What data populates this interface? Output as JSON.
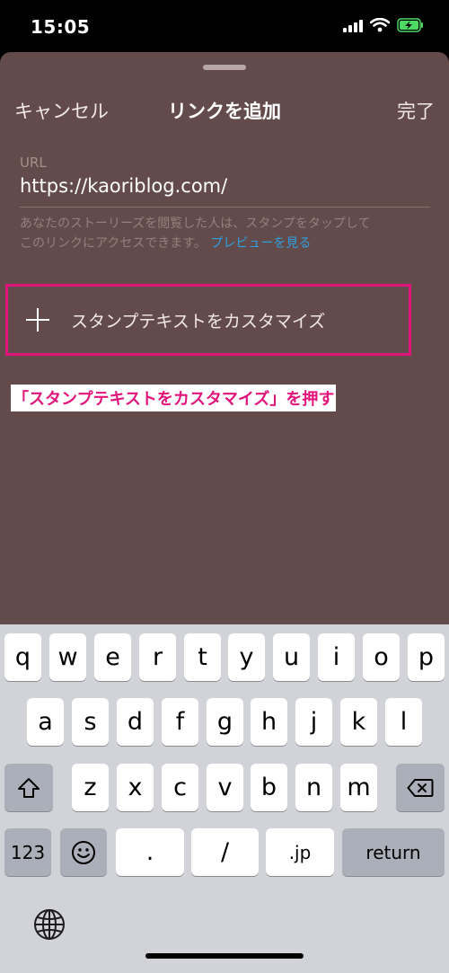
{
  "status_bar": {
    "time": "15:05"
  },
  "nav": {
    "cancel": "キャンセル",
    "title": "リンクを追加",
    "done": "完了"
  },
  "url_field": {
    "label": "URL",
    "value": "https://kaoriblog.com/"
  },
  "helper": {
    "line1": "あなたのストーリーズを閲覧した人は、スタンプをタップして",
    "line2": "このリンクにアクセスできます。",
    "preview_link": "プレビューを見る"
  },
  "customize": {
    "label": "スタンプテキストをカスタマイズ"
  },
  "annotation": {
    "text": "「スタンプテキストをカスタマイズ」を押す"
  },
  "keyboard": {
    "row1": [
      "q",
      "w",
      "e",
      "r",
      "t",
      "y",
      "u",
      "i",
      "o",
      "p"
    ],
    "row2": [
      "a",
      "s",
      "d",
      "f",
      "g",
      "h",
      "j",
      "k",
      "l"
    ],
    "row3": [
      "z",
      "x",
      "c",
      "v",
      "b",
      "n",
      "m"
    ],
    "numbers": "123",
    "dot": ".",
    "slash": "/",
    "jp": ".jp",
    "return": "return"
  },
  "colors": {
    "sheet": "#634b4b",
    "highlight": "#e1147b",
    "link": "#2f9fe0",
    "keyboard": "#d1d3d9"
  }
}
